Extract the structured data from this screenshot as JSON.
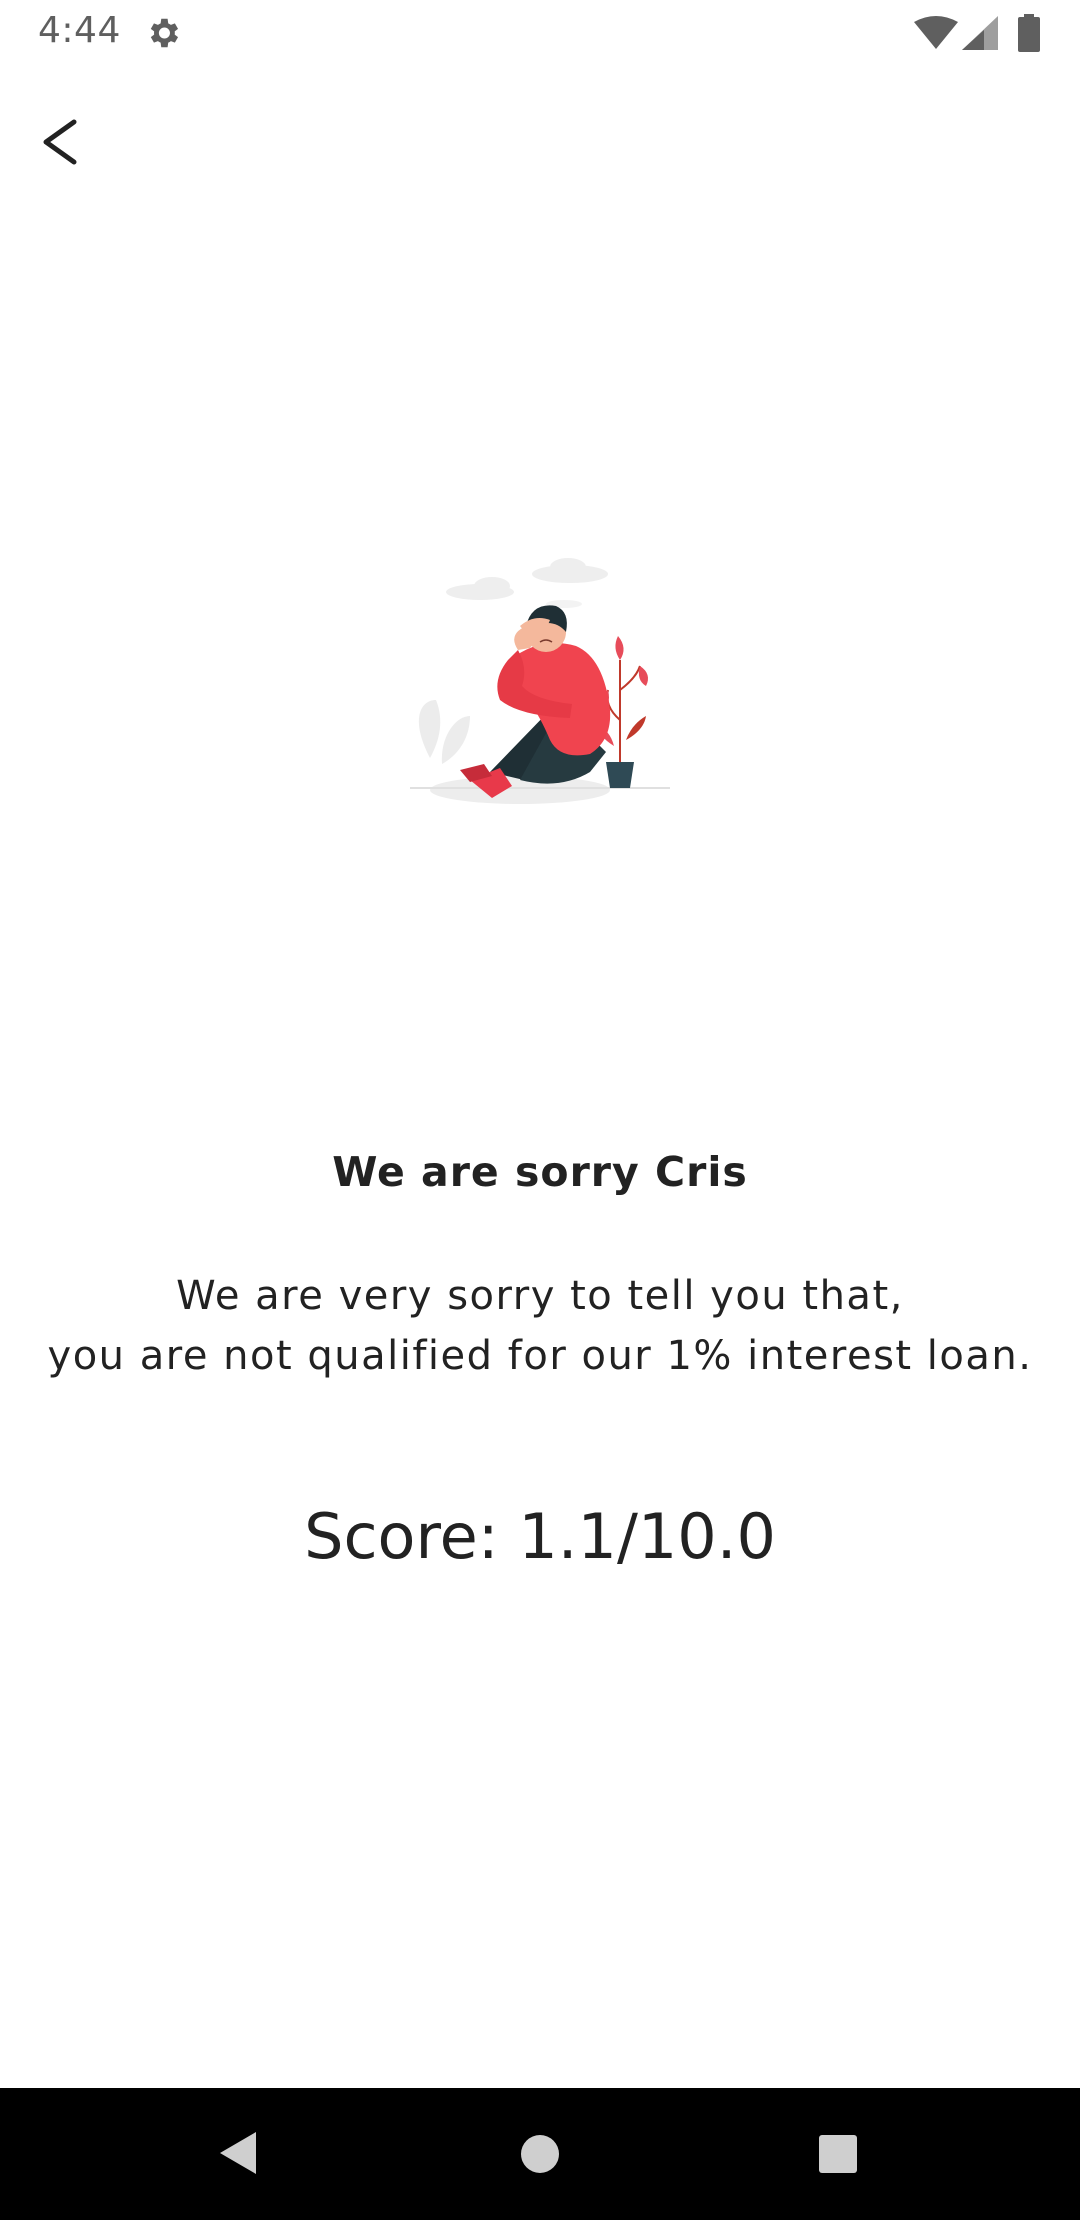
{
  "status_bar": {
    "time": "4:44",
    "icons": [
      "gear-icon",
      "wifi-icon",
      "signal-icon",
      "battery-icon"
    ]
  },
  "header": {
    "back_icon": "chevron-left-icon"
  },
  "illustration": {
    "icon": "sad-person-illustration"
  },
  "result": {
    "title": "We are sorry Cris",
    "message_line_1": "We are very sorry to tell you that,",
    "message_line_2": "you are not qualified for our 1% interest loan.",
    "score": "Score: 1.1/10.0"
  },
  "nav_bar": {
    "icons": [
      "nav-back-icon",
      "nav-home-icon",
      "nav-recents-icon"
    ]
  },
  "colors": {
    "accent": "#f0444f",
    "text": "#222222",
    "status_text": "#5f5f5f",
    "nav_background": "#000000"
  }
}
